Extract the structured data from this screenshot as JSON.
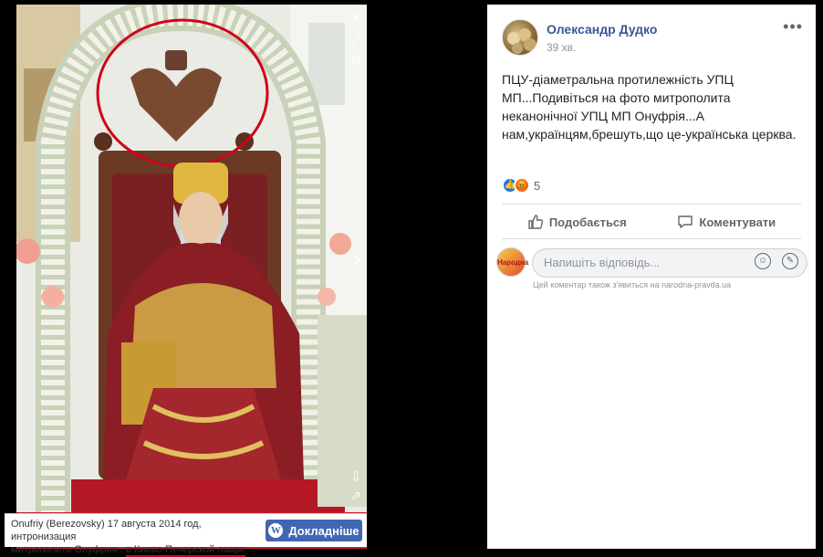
{
  "photo": {
    "caption_line1": "Onufriy (Berezovsky) 17 августа 2014 год, интронизация",
    "caption_line2_a": "митрополита Онуфрия ,",
    "caption_line2_b": "в Киево-Печерской лавре",
    "more_button_label": "Докладніше",
    "more_button_icon": "W"
  },
  "post": {
    "author": "Олександр Дудко",
    "time": "39 хв.",
    "menu_dots": "•••",
    "text": "ПЦУ-діаметральна протилежність УПЦ МП...Подивіться на фото митрополита неканонічної УПЦ МП Онуфрія...А нам,українцям,брешуть,що це-українська церква.",
    "reaction_count": "5",
    "like_label": "Подобається",
    "comment_label": "Коментувати",
    "comment_placeholder": "Напишіть відповідь...",
    "comment_note": "Цей коментар також з'явиться на narodna-pravda.ua",
    "commenter_avatar_text": "Народна"
  },
  "colors": {
    "link_blue": "#385898",
    "button_blue": "#4267b2",
    "highlight_red": "#d0021b"
  }
}
